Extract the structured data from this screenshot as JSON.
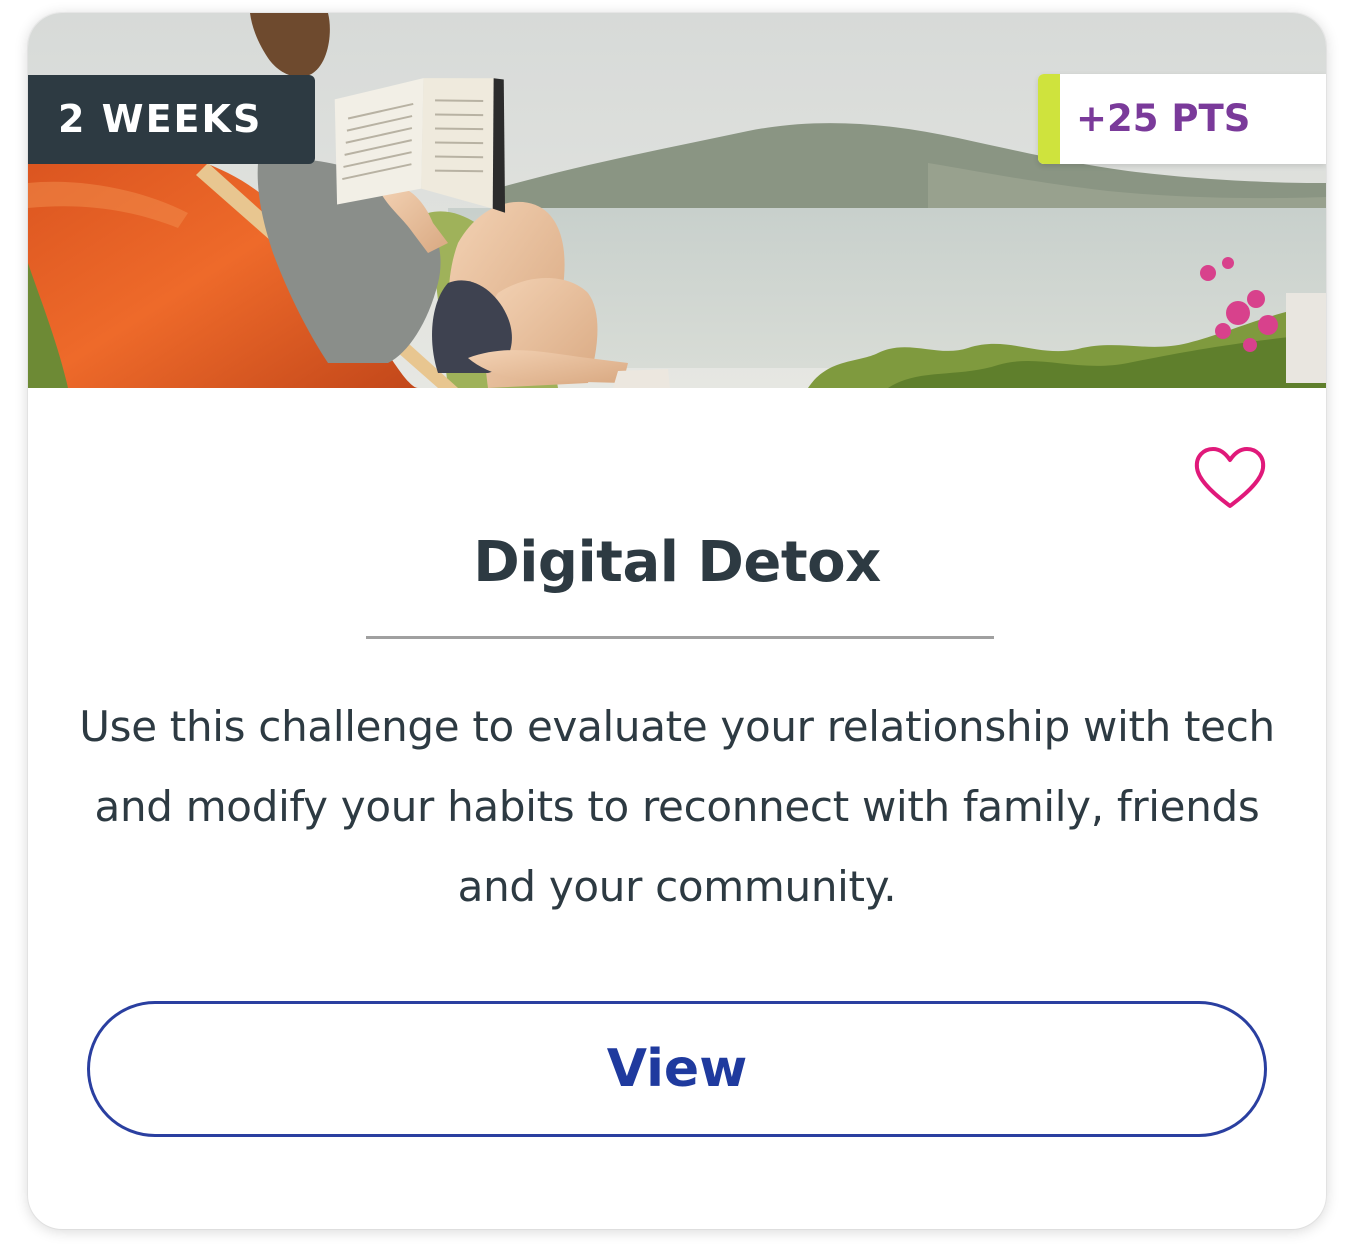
{
  "card": {
    "duration_label": "2 WEEKS",
    "points_label": "+25 PTS",
    "title": "Digital Detox",
    "description": "Use this challenge to evaluate your relationship with tech and modify your habits to reconnect with family, friends and your community.",
    "view_label": "View"
  },
  "icons": {
    "favorite": "heart-outline-icon"
  },
  "colors": {
    "duration_badge_bg": "#2d3a42",
    "points_text": "#7a3a9a",
    "points_accent": "#cfe33d",
    "heart": "#e0197a",
    "button_border": "#2a3fa0",
    "button_text": "#1f3a9e",
    "title_text": "#2d3a42"
  }
}
